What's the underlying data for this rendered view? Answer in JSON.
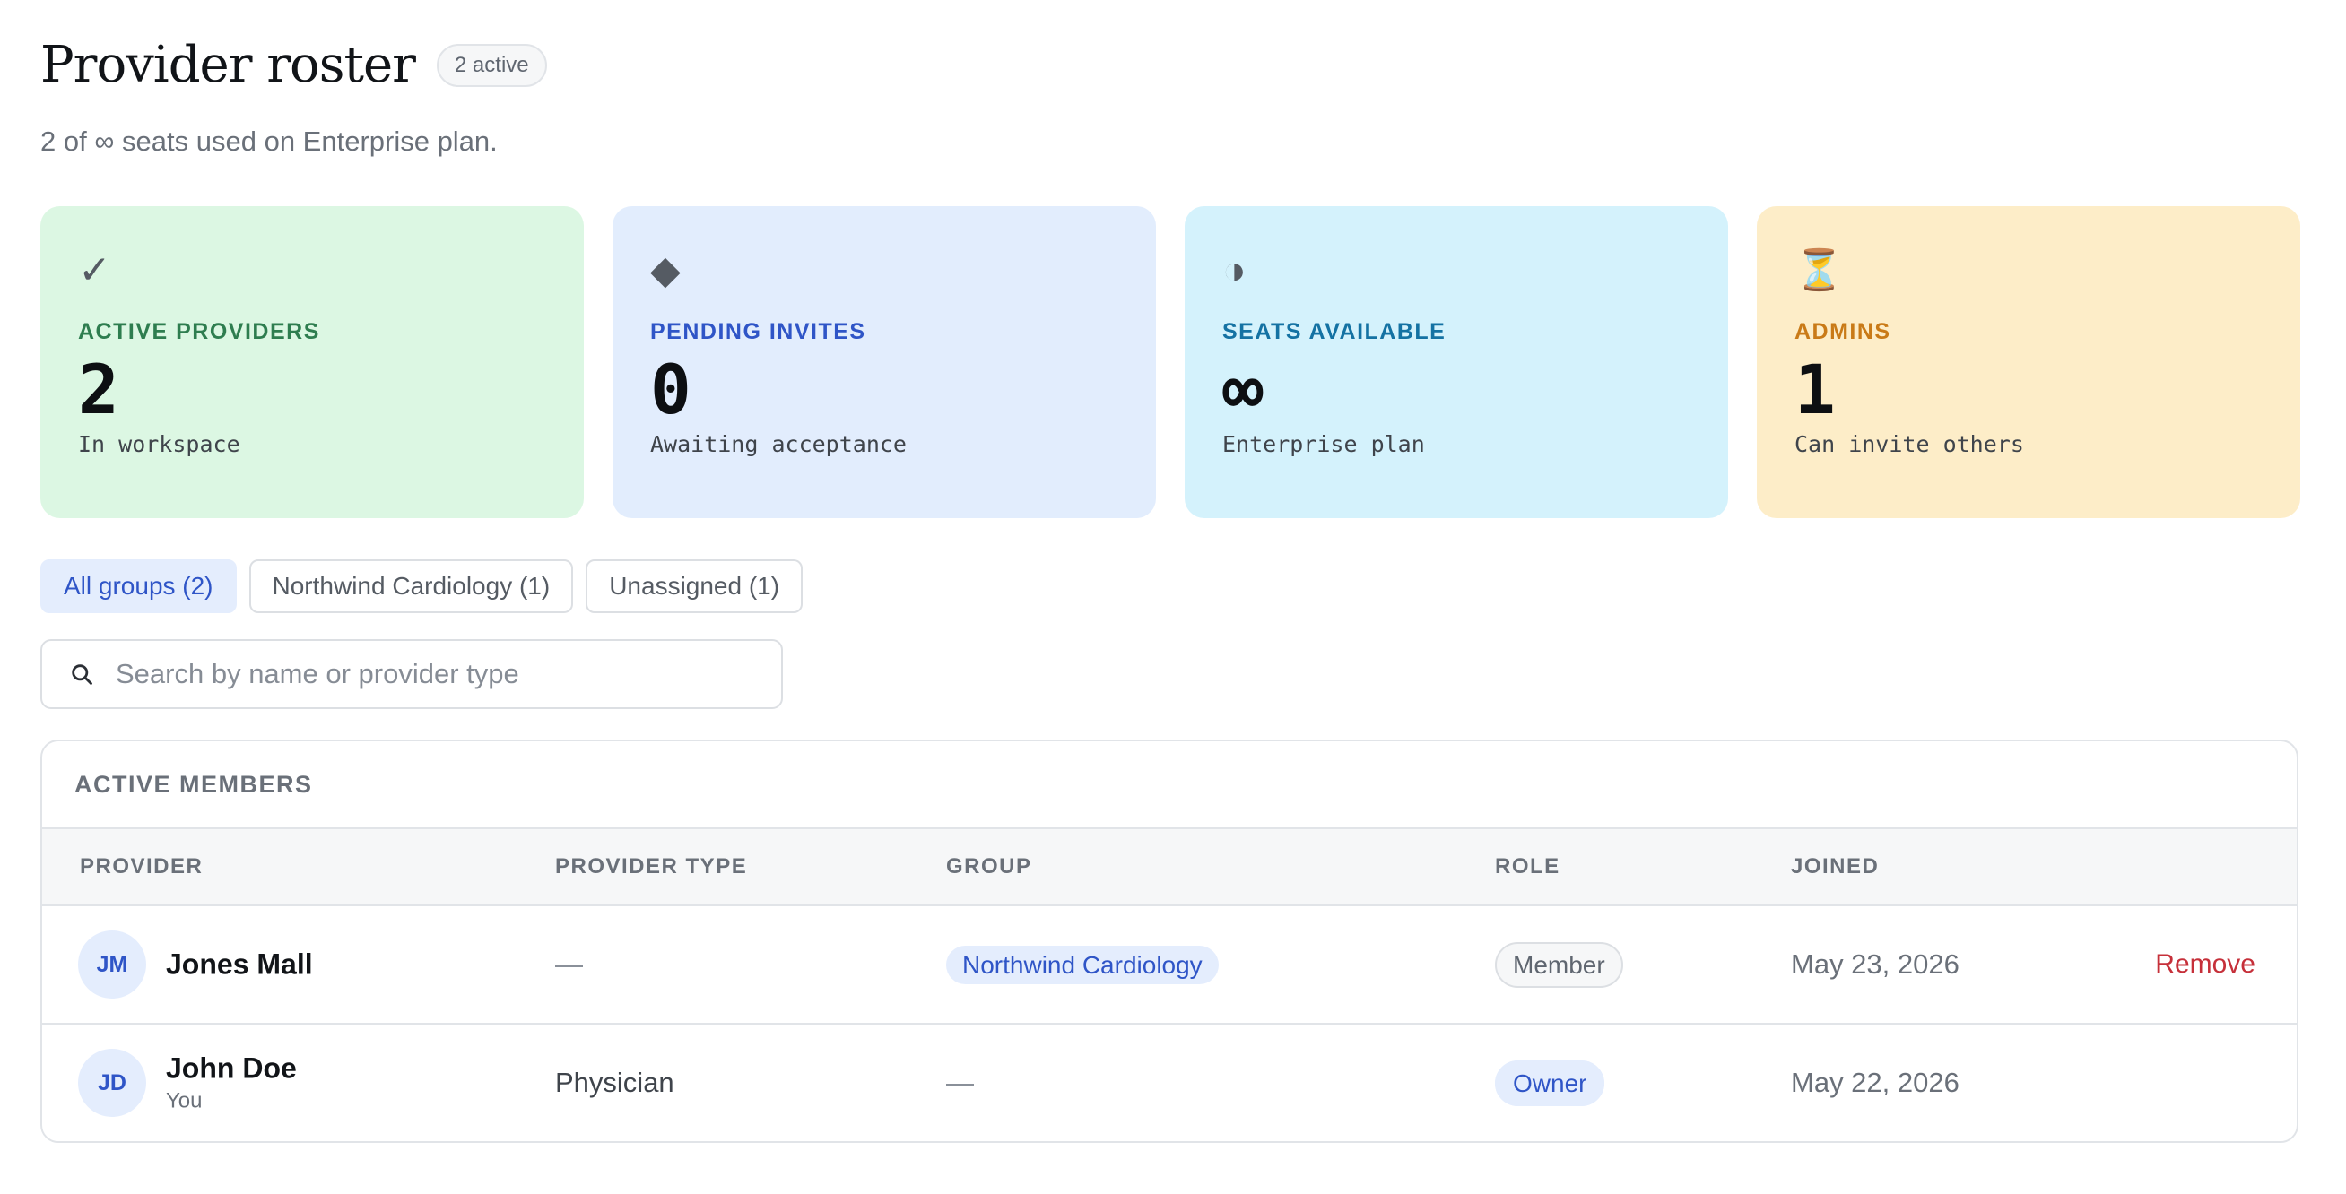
{
  "header": {
    "title": "Provider roster",
    "active_badge": "2 active",
    "subtitle": "2 of ∞ seats used on Enterprise plan."
  },
  "stats": [
    {
      "icon": "checkmark-icon",
      "glyph": "✓",
      "label": "ACTIVE PROVIDERS",
      "value": "2",
      "desc": "In workspace",
      "bg": "#dcf7e3",
      "accent": "#2e7d4f"
    },
    {
      "icon": "diamond-icon",
      "glyph": "◆",
      "label": "PENDING INVITES",
      "value": "0",
      "desc": "Awaiting acceptance",
      "bg": "#e2edfd",
      "accent": "#2f55c7"
    },
    {
      "icon": "half-circle-icon",
      "glyph": "◑",
      "label": "SEATS AVAILABLE",
      "value": "∞",
      "desc": "Enterprise plan",
      "bg": "#d4f2fc",
      "accent": "#1472a3"
    },
    {
      "icon": "hourglass-icon",
      "glyph": "⏳",
      "label": "ADMINS",
      "value": "1",
      "desc": "Can invite others",
      "bg": "#fdedc8",
      "accent": "#c97a17"
    }
  ],
  "filters": [
    {
      "label": "All groups (2)",
      "active": true
    },
    {
      "label": "Northwind Cardiology (1)",
      "active": false
    },
    {
      "label": "Unassigned (1)",
      "active": false
    }
  ],
  "search": {
    "placeholder": "Search by name or provider type",
    "value": ""
  },
  "table": {
    "title": "ACTIVE MEMBERS",
    "columns": [
      "PROVIDER",
      "PROVIDER TYPE",
      "GROUP",
      "ROLE",
      "JOINED"
    ],
    "rows": [
      {
        "initials": "JM",
        "name": "Jones Mall",
        "sub": "",
        "type": "—",
        "group": "Northwind Cardiology",
        "role": "Member",
        "joined": "May 23, 2026",
        "action": "Remove"
      },
      {
        "initials": "JD",
        "name": "John Doe",
        "sub": "You",
        "type": "Physician",
        "group": "—",
        "role": "Owner",
        "joined": "May 22, 2026",
        "action": ""
      }
    ]
  }
}
